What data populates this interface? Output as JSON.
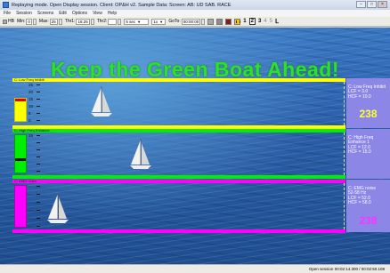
{
  "window": {
    "title": "Replaying mode. Open Display session. Client: OP&H v2. Sample Data: Screen: AB: UD SAB. RACE"
  },
  "menu": [
    "File",
    "Session",
    "Screens",
    "Edit",
    "Options",
    "View",
    "Help"
  ],
  "toolbar": {
    "hb_label": "HB",
    "min_label": "Min:",
    "min_value": "0",
    "max_label": "Max:",
    "max_value": "25",
    "thr1_label": "Thr1:",
    "thr1_value": "18.25",
    "thr2_label": "Thr2:",
    "thr2_value": "",
    "interval_value": "5 sec",
    "speed_value": "1x",
    "goto_label": "GoTo:",
    "goto_value": "00:00:00",
    "page_numbers": [
      "1",
      "2",
      "3",
      "4",
      "5"
    ],
    "active_page": "2"
  },
  "headline": "Keep the Green Boat Ahead!",
  "panels": [
    {
      "label": "C: Low Freq Inhibit",
      "color": "#ffff00",
      "ticks": [
        "25",
        "20",
        "15",
        "10",
        "5",
        "0"
      ],
      "info_lines": "C: Low Freq Inhibit\nLCF = 3.0\nHCF = 10.0",
      "score": "238",
      "score_color": "#ffff33"
    },
    {
      "label": "C: High Freq Enhance",
      "color": "#00ee00",
      "ticks": [
        "15",
        "",
        "",
        "",
        "",
        ""
      ],
      "info_lines": "C: High Freq\nEnhance 1\nLCF = 12.0\nHCF = 15.0",
      "score": "",
      "score_color": "#ffffff"
    },
    {
      "label": "C: EMG noise",
      "color": "#ff00ff",
      "ticks": [
        "",
        "",
        "",
        "",
        "",
        ""
      ],
      "info_lines": "C: EMG noise\n52-58 Hz\nLCF = 52.0\nHCF = 58.0",
      "score": "238",
      "score_color": "#ff33ff"
    }
  ],
  "status": {
    "text": "Open session 00:02:14.300 / 00:02:50.108"
  }
}
